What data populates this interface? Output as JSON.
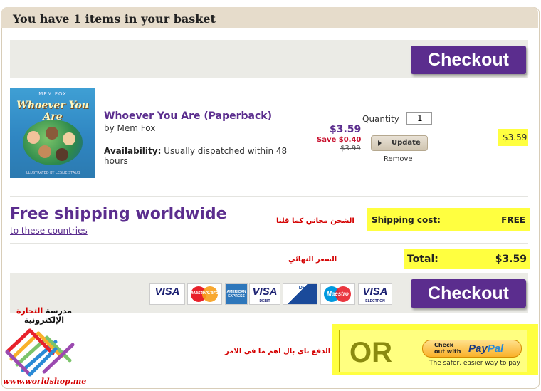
{
  "header": {
    "title": "You have 1 items in your basket"
  },
  "checkout": {
    "label": "Checkout"
  },
  "product": {
    "cover": {
      "author": "MEM FOX",
      "title": "Whoever You Are",
      "illustrator": "ILLUSTRATED BY LESLIE STAUB"
    },
    "title": "Whoever You Are (Paperback)",
    "author": "by Mem Fox",
    "availability_label": "Availability:",
    "availability_text": "Usually dispatched within 48 hours",
    "price": "$3.59",
    "save": "Save $0.40",
    "old_price": "$3.99",
    "quantity_label": "Quantity",
    "quantity_value": "1",
    "update_label": "Update",
    "remove_label": "Remove",
    "line_total": "$3.59"
  },
  "shipping": {
    "headline": "Free shipping worldwide",
    "link": "to these countries",
    "arabic_note": "الشحن مجاني كما قلنا",
    "cost_label": "Shipping cost:",
    "cost_value": "FREE"
  },
  "total": {
    "arabic_note": "السعر النهائي",
    "label": "Total:",
    "value": "$3.59"
  },
  "cards": [
    "VISA",
    "MasterCard",
    "AMERICAN EXPRESS",
    "VISA",
    "DELTA",
    "Maestro",
    "VISA"
  ],
  "card_subs": {
    "debit": "DEBIT",
    "electron": "ELECTRON"
  },
  "paypal": {
    "arabic_note": "الدفع باي بال اهم ما في الامر",
    "or": "OR",
    "check_out_with": "Check out with",
    "pay": "Pay",
    "pal": "Pal",
    "tagline": "The safer, easier way to pay"
  },
  "watermark": {
    "arabic_part1": "مدرسة ",
    "arabic_part2": "التجارة",
    "arabic_part3": " الإلكترونية",
    "url": "www.worldshop.me"
  },
  "colors": {
    "purple": "#5b2d8e",
    "highlight": "#ffff40",
    "header": "#e6dccb",
    "sale_red": "#c8102e"
  }
}
